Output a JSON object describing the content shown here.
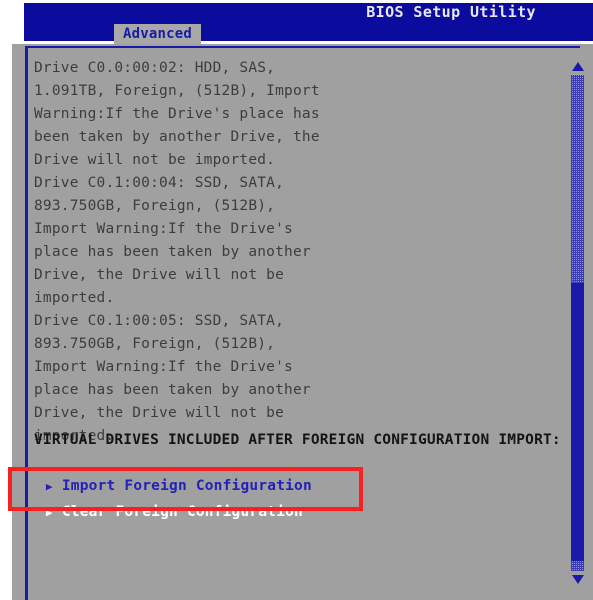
{
  "header": {
    "title": "BIOS Setup Utility",
    "tabs": [
      {
        "label": "Advanced",
        "active": true
      }
    ]
  },
  "colors": {
    "header_blue": "#0b0b9e",
    "panel_gray": "#a0a0a0",
    "tab_gray": "#a8a8a8",
    "accent_blue": "#1a1aa8",
    "link_blue": "#2222b4",
    "selected_text": "#ffffff",
    "body_text": "#3d3d3d",
    "annotation_red": "#fb1f1f"
  },
  "main": {
    "drive_info_lines": [
      "Drive C0.0:00:02: HDD, SAS,",
      "1.091TB, Foreign, (512B), Import",
      "Warning:If the Drive's place has",
      "been taken by another Drive, the",
      "Drive will not be imported.",
      "Drive C0.1:00:04: SSD, SATA,",
      "893.750GB, Foreign, (512B),",
      "Import Warning:If the Drive's",
      "place has been taken by another",
      "Drive, the Drive will not be",
      "imported.",
      "Drive C0.1:00:05: SSD, SATA,",
      "893.750GB, Foreign, (512B),",
      "Import Warning:If the Drive's",
      "place has been taken by another",
      "Drive, the Drive will not be",
      "imported."
    ],
    "section_heading": "VIRTUAL DRIVES INCLUDED AFTER FOREIGN CONFIGURATION IMPORT:",
    "menu_items": [
      {
        "label": "Import Foreign Configuration",
        "arrow": "▶",
        "selected": false
      },
      {
        "label": "Clear Foreign Configuration",
        "arrow": "▶",
        "selected": true
      }
    ]
  },
  "scrollbar": {
    "up_arrow": "scroll-up-arrow",
    "down_arrow": "scroll-down-arrow",
    "thumb_top_percent": 42,
    "thumb_height_percent": 56
  },
  "annotation": {
    "shape": "rectangle",
    "target": "Clear Foreign Configuration"
  }
}
